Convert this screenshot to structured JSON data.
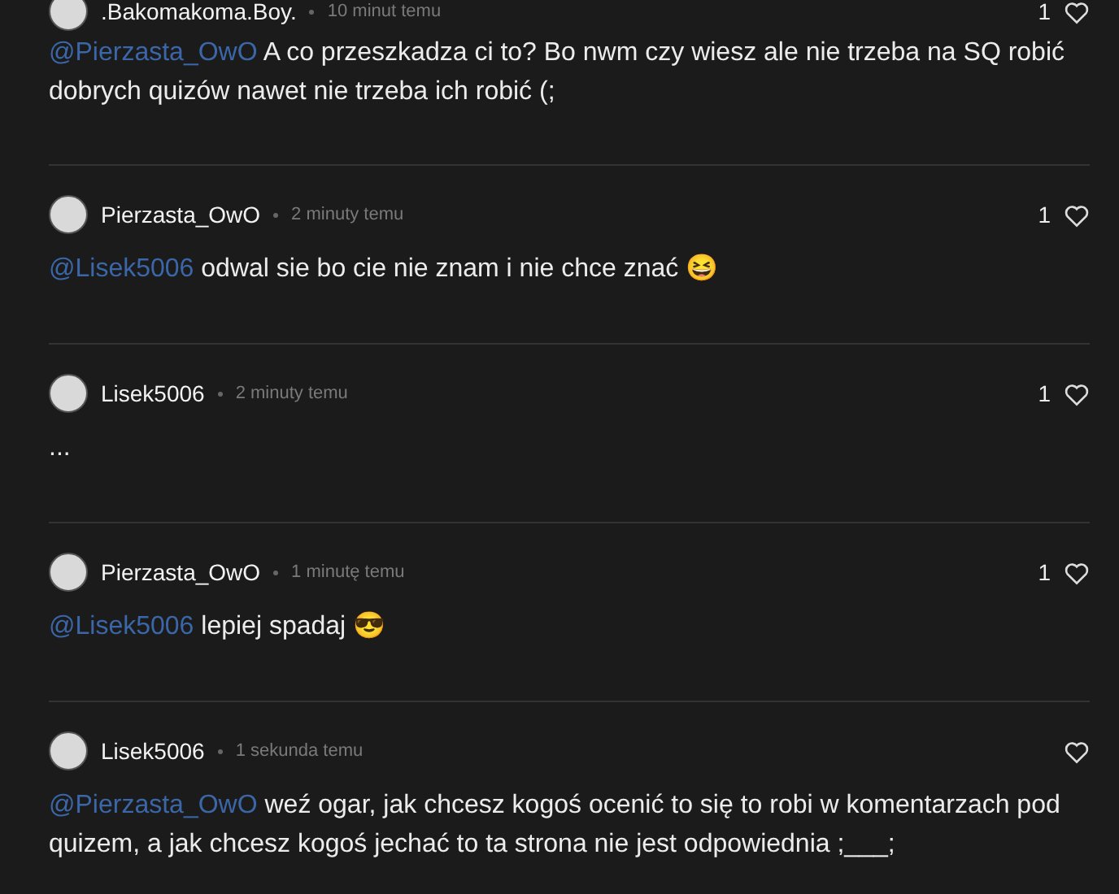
{
  "comments": [
    {
      "author": ".Bakomakoma.Boy.",
      "time": "10 minut temu",
      "likes": "1",
      "mention": "@Pierzasta_OwO",
      "text": "A co przeszkadza ci to? Bo nwm czy wiesz ale nie trzeba na SQ robić dobrych quizów nawet nie trzeba ich robić (;"
    },
    {
      "author": "Pierzasta_OwO",
      "time": "2 minuty temu",
      "likes": "1",
      "mention": "@Lisek5006",
      "text": "odwal sie bo cie nie znam i nie chce znać 😆"
    },
    {
      "author": "Lisek5006",
      "time": "2 minuty temu",
      "likes": "1",
      "text": "..."
    },
    {
      "author": "Pierzasta_OwO",
      "time": "1 minutę temu",
      "likes": "1",
      "mention": "@Lisek5006",
      "text": "lepiej spadaj 😎"
    },
    {
      "author": "Lisek5006",
      "time": "1 sekunda temu",
      "mention": "@Pierzasta_OwO",
      "text": "weź ogar, jak chcesz kogoś ocenić to się to robi w komentarzach pod quizem, a jak chcesz kogoś jechać to ta strona nie jest odpowiednia ;___;"
    }
  ]
}
